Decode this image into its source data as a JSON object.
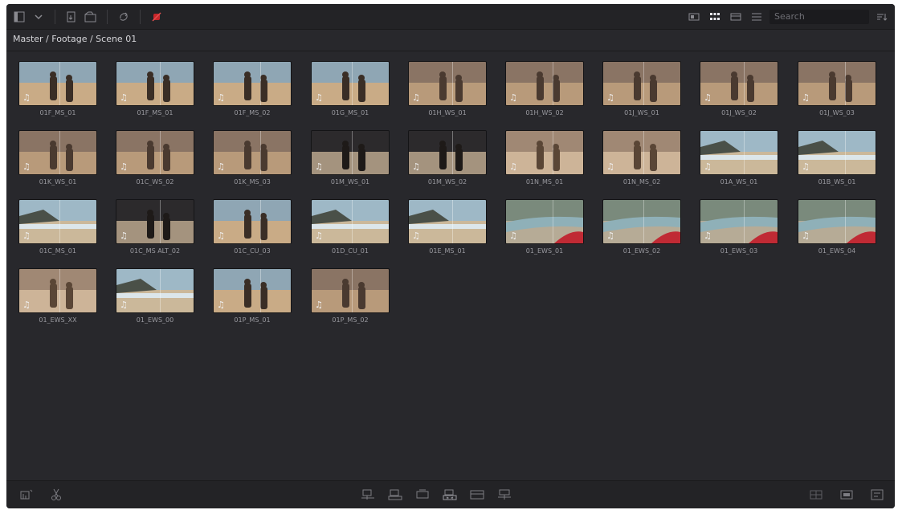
{
  "toolbar": {
    "search_placeholder": "Search",
    "left_icons": [
      "sidebar-toggle-icon",
      "chevron-down-icon",
      "import-media-icon",
      "new-bin-icon",
      "sync-icon",
      "no-audio-icon"
    ],
    "right_icons": [
      "thumbnail-view-icon",
      "grid-view-icon",
      "filmstrip-view-icon",
      "list-view-icon"
    ],
    "accent_red": "#c8262a"
  },
  "breadcrumb": "Master / Footage / Scene 01",
  "clips": [
    {
      "label": "01F_MS_01",
      "scene": "people",
      "audio": true
    },
    {
      "label": "01F_MS_01",
      "scene": "people",
      "audio": true
    },
    {
      "label": "01F_MS_02",
      "scene": "people",
      "audio": true
    },
    {
      "label": "01G_MS_01",
      "scene": "people",
      "audio": true
    },
    {
      "label": "01H_WS_01",
      "scene": "rocks",
      "audio": true
    },
    {
      "label": "01H_WS_02",
      "scene": "rocks",
      "audio": true
    },
    {
      "label": "01J_WS_01",
      "scene": "rocks",
      "audio": true
    },
    {
      "label": "01J_WS_02",
      "scene": "rocks",
      "audio": true
    },
    {
      "label": "01J_WS_03",
      "scene": "rocks",
      "audio": true
    },
    {
      "label": "01K_WS_01",
      "scene": "rocks",
      "audio": true
    },
    {
      "label": "01C_WS_02",
      "scene": "rocks",
      "audio": true
    },
    {
      "label": "01K_MS_03",
      "scene": "rocks",
      "audio": true
    },
    {
      "label": "01M_WS_01",
      "scene": "dark",
      "audio": true
    },
    {
      "label": "01M_WS_02",
      "scene": "dark",
      "audio": true
    },
    {
      "label": "01N_MS_01",
      "scene": "sand",
      "audio": true
    },
    {
      "label": "01N_MS_02",
      "scene": "sand",
      "audio": true
    },
    {
      "label": "01A_WS_01",
      "scene": "beach",
      "audio": true
    },
    {
      "label": "01B_WS_01",
      "scene": "beach",
      "audio": true
    },
    {
      "label": "01C_MS_01",
      "scene": "beach",
      "audio": true
    },
    {
      "label": "01C_MS ALT_02",
      "scene": "dark",
      "audio": true
    },
    {
      "label": "01C_CU_03",
      "scene": "people",
      "audio": true
    },
    {
      "label": "01D_CU_01",
      "scene": "beach",
      "audio": true
    },
    {
      "label": "01E_MS_01",
      "scene": "beach",
      "audio": true
    },
    {
      "label": "01_EWS_01",
      "scene": "cove",
      "audio": true
    },
    {
      "label": "01_EWS_02",
      "scene": "cove",
      "audio": true
    },
    {
      "label": "01_EWS_03",
      "scene": "cove",
      "audio": true
    },
    {
      "label": "01_EWS_04",
      "scene": "cove",
      "audio": true
    },
    {
      "label": "01_EWS_XX",
      "scene": "sand",
      "audio": true
    },
    {
      "label": "01_EWS_00",
      "scene": "beach",
      "audio": true
    },
    {
      "label": "01P_MS_01",
      "scene": "people",
      "audio": true
    },
    {
      "label": "01P_MS_02",
      "scene": "rocks",
      "audio": true
    }
  ],
  "bottombar": {
    "left_icons": [
      "metadata-icon",
      "scissors-icon"
    ],
    "center_icons": [
      "insert-clip-icon",
      "overwrite-clip-icon",
      "replace-clip-icon",
      "fit-to-fill-icon",
      "place-on-top-icon",
      "append-icon"
    ],
    "right_icons": [
      "source-viewer-icon",
      "timeline-viewer-icon",
      "full-screen-icon"
    ]
  }
}
